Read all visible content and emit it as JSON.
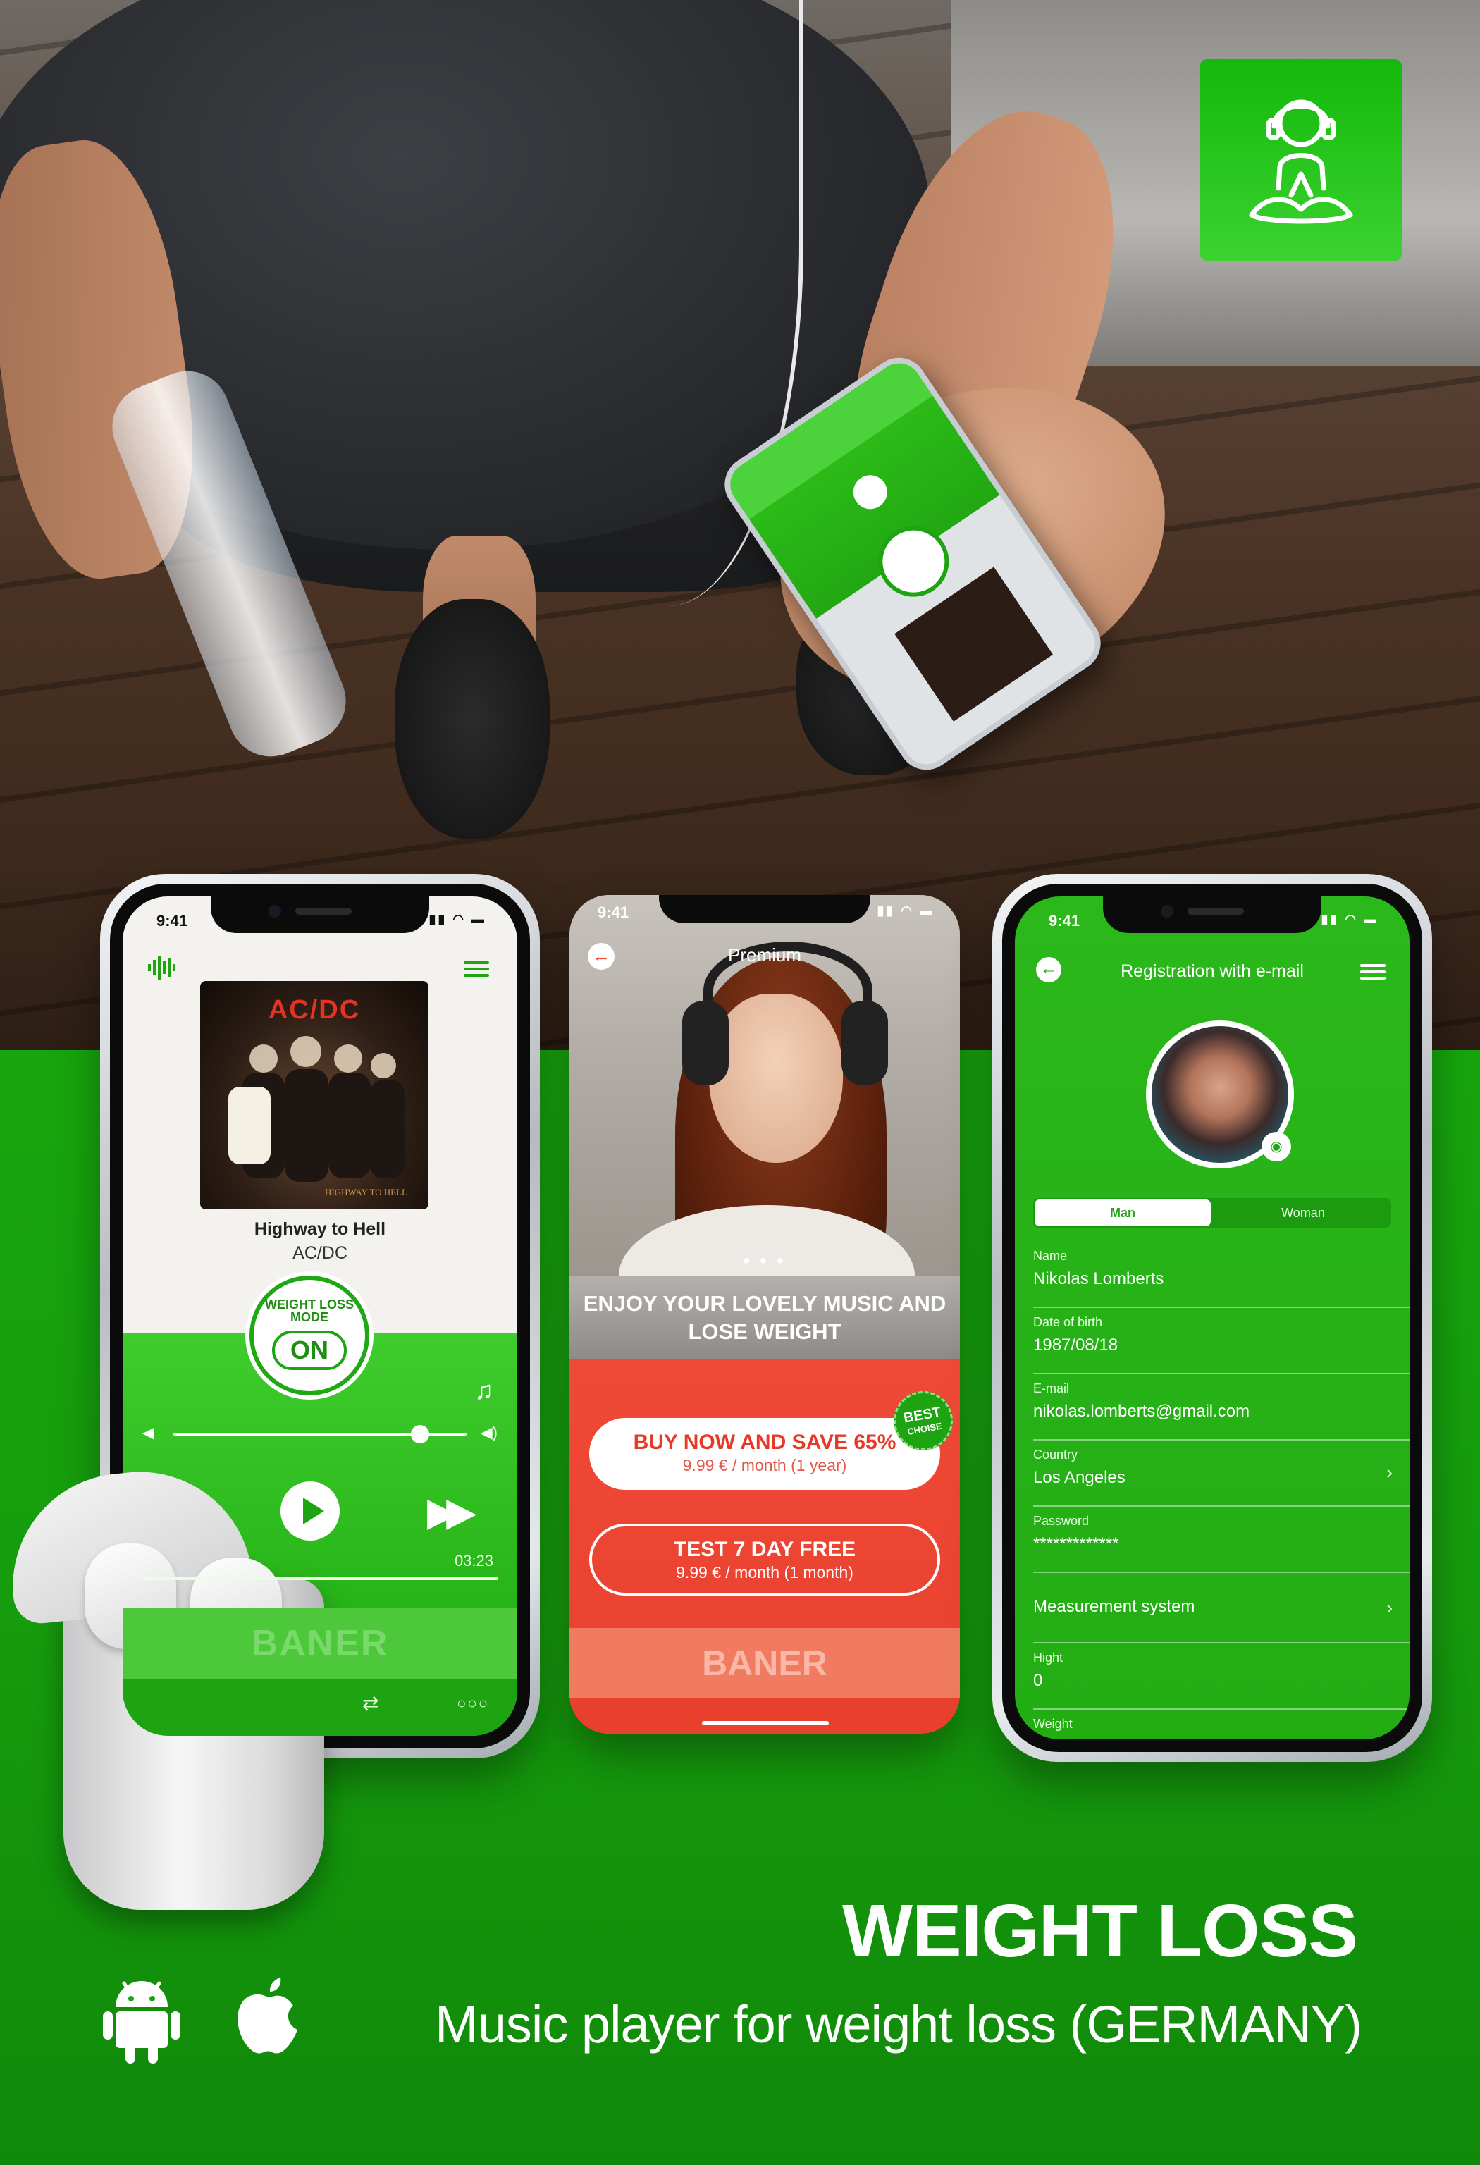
{
  "colors": {
    "brand_green": "#1ea313",
    "accent_red": "#ee4c39",
    "white": "#ffffff"
  },
  "app_icon": {
    "icon": "meditation-headphones-icon"
  },
  "hand_phone": {
    "banner_label": "BANER",
    "badge_label": "ON",
    "track": "Highway to Hell",
    "artist": "AC/DC"
  },
  "player": {
    "status_time": "9:41",
    "status_icons": "signal wifi battery",
    "equalizer_icon": "equalizer-icon",
    "menu_icon": "menu-icon",
    "album_logo": "AC/DC",
    "album_subtitle": "HIGHWAY TO HELL",
    "track_title": "Highway to Hell",
    "artist": "AC/DC",
    "weight_loss_mode_label": "WEIGHT LOSS MODE",
    "mode_state": "ON",
    "volume_level": 0.85,
    "time_remaining": "03:23",
    "banner": "BANER"
  },
  "premium": {
    "status_time": "9:41",
    "title": "Premium",
    "headline": "ENJOY YOUR LOVELY MUSIC AND LOSE WEIGHT",
    "carousel_dots": "● ● ●",
    "offer_yearly": {
      "title": "BUY NOW AND SAVE 65%",
      "price": "9.99 € / month (1 year)"
    },
    "best_badge": {
      "line1": "BEST",
      "line2": "CHOISE"
    },
    "offer_trial": {
      "title": "TEST 7 DAY FREE",
      "price": "9.99 € / month (1 month)"
    },
    "banner": "BANER"
  },
  "registration": {
    "status_time": "9:41",
    "title": "Registration with e-mail",
    "gender_options": [
      "Man",
      "Woman"
    ],
    "selected_gender": "Man",
    "fields": [
      {
        "label": "Name",
        "value": "Nikolas Lomberts"
      },
      {
        "label": "Date of birth",
        "value": "1987/08/18"
      },
      {
        "label": "E-mail",
        "value": "nikolas.lomberts@gmail.com"
      },
      {
        "label": "Country",
        "value": "Los Angeles"
      },
      {
        "label": "Password",
        "value": "*************"
      },
      {
        "label": "Measurement system",
        "value": ""
      },
      {
        "label": "Hight",
        "value": "0"
      },
      {
        "label": "Weight",
        "value": ""
      }
    ]
  },
  "footer": {
    "title": "WEIGHT LOSS",
    "subtitle": "Music player for weight loss (GERMANY)",
    "platforms": [
      "android-icon",
      "apple-icon"
    ]
  }
}
